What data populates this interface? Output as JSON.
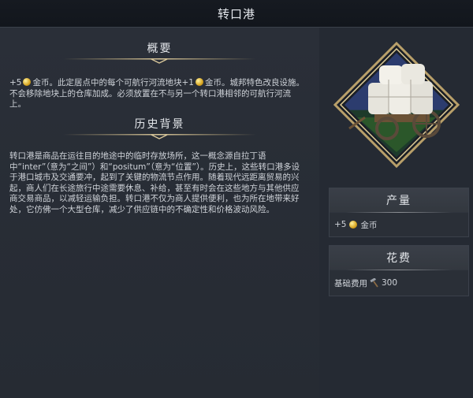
{
  "title": "转口港",
  "overview": {
    "heading": "概要",
    "text_a": "+5",
    "text_b": "金币。此定居点中的每个可航行河流地块+1",
    "text_c": "金币。城邦特色改良设施。不会移除地块上的仓库加成。必须放置在不与另一个转口港相邻的可航行河流上。"
  },
  "history": {
    "heading": "历史背景",
    "text": "转口港是商品在运往目的地途中的临时存放场所，这一概念源自拉丁语中“inter”（意为“之间”）和“positum”（意为“位置”）。历史上，这些转口港多设于港口城市及交通要冲，起到了关键的物流节点作用。随着现代远距离贸易的兴起，商人们在长途旅行中途需要休息、补给，甚至有时会在这些地方与其他供应商交易商品，以减轻运输负担。转口港不仅为商人提供便利，也为所在地带来好处，它仿佛一个大型仓库，减少了供应链中的不确定性和价格波动风险。"
  },
  "yield": {
    "heading": "产量",
    "amount": "+5",
    "label": "金币",
    "icon": "gold-coin-icon"
  },
  "cost": {
    "heading": "花费",
    "label": "基础费用",
    "amount": "300",
    "icon": "hammer-icon"
  },
  "colors": {
    "gold": "#d8a520",
    "frame": "#c9b27a",
    "panel": "#2a2f38"
  }
}
